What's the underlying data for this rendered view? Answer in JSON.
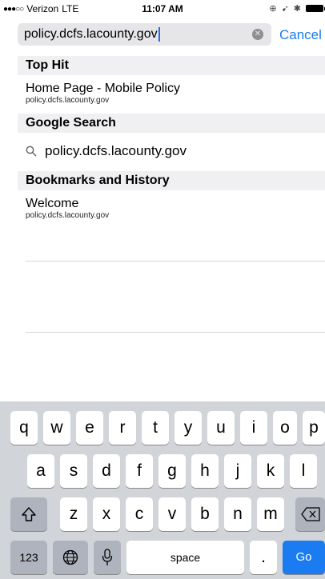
{
  "status": {
    "carrier": "Verizon",
    "network": "LTE",
    "time": "11:07 AM"
  },
  "url_bar": {
    "value": "policy.dcfs.lacounty.gov",
    "cancel_label": "Cancel"
  },
  "sections": {
    "top_hit": "Top Hit",
    "google_search": "Google Search",
    "bookmarks_history": "Bookmarks and History"
  },
  "top_hit": {
    "title": "Home Page - Mobile Policy",
    "url": "policy.dcfs.lacounty.gov"
  },
  "google_suggestion": "policy.dcfs.lacounty.gov",
  "history_item": {
    "title": "Welcome",
    "url": "policy.dcfs.lacounty.gov"
  },
  "keyboard": {
    "row1": [
      "q",
      "w",
      "e",
      "r",
      "t",
      "y",
      "u",
      "i",
      "o",
      "p"
    ],
    "row2": [
      "a",
      "s",
      "d",
      "f",
      "g",
      "h",
      "j",
      "k",
      "l"
    ],
    "row3": [
      "z",
      "x",
      "c",
      "v",
      "b",
      "n",
      "m"
    ],
    "numbers_label": "123",
    "space_label": "space",
    "period_label": ".",
    "go_label": "Go"
  }
}
